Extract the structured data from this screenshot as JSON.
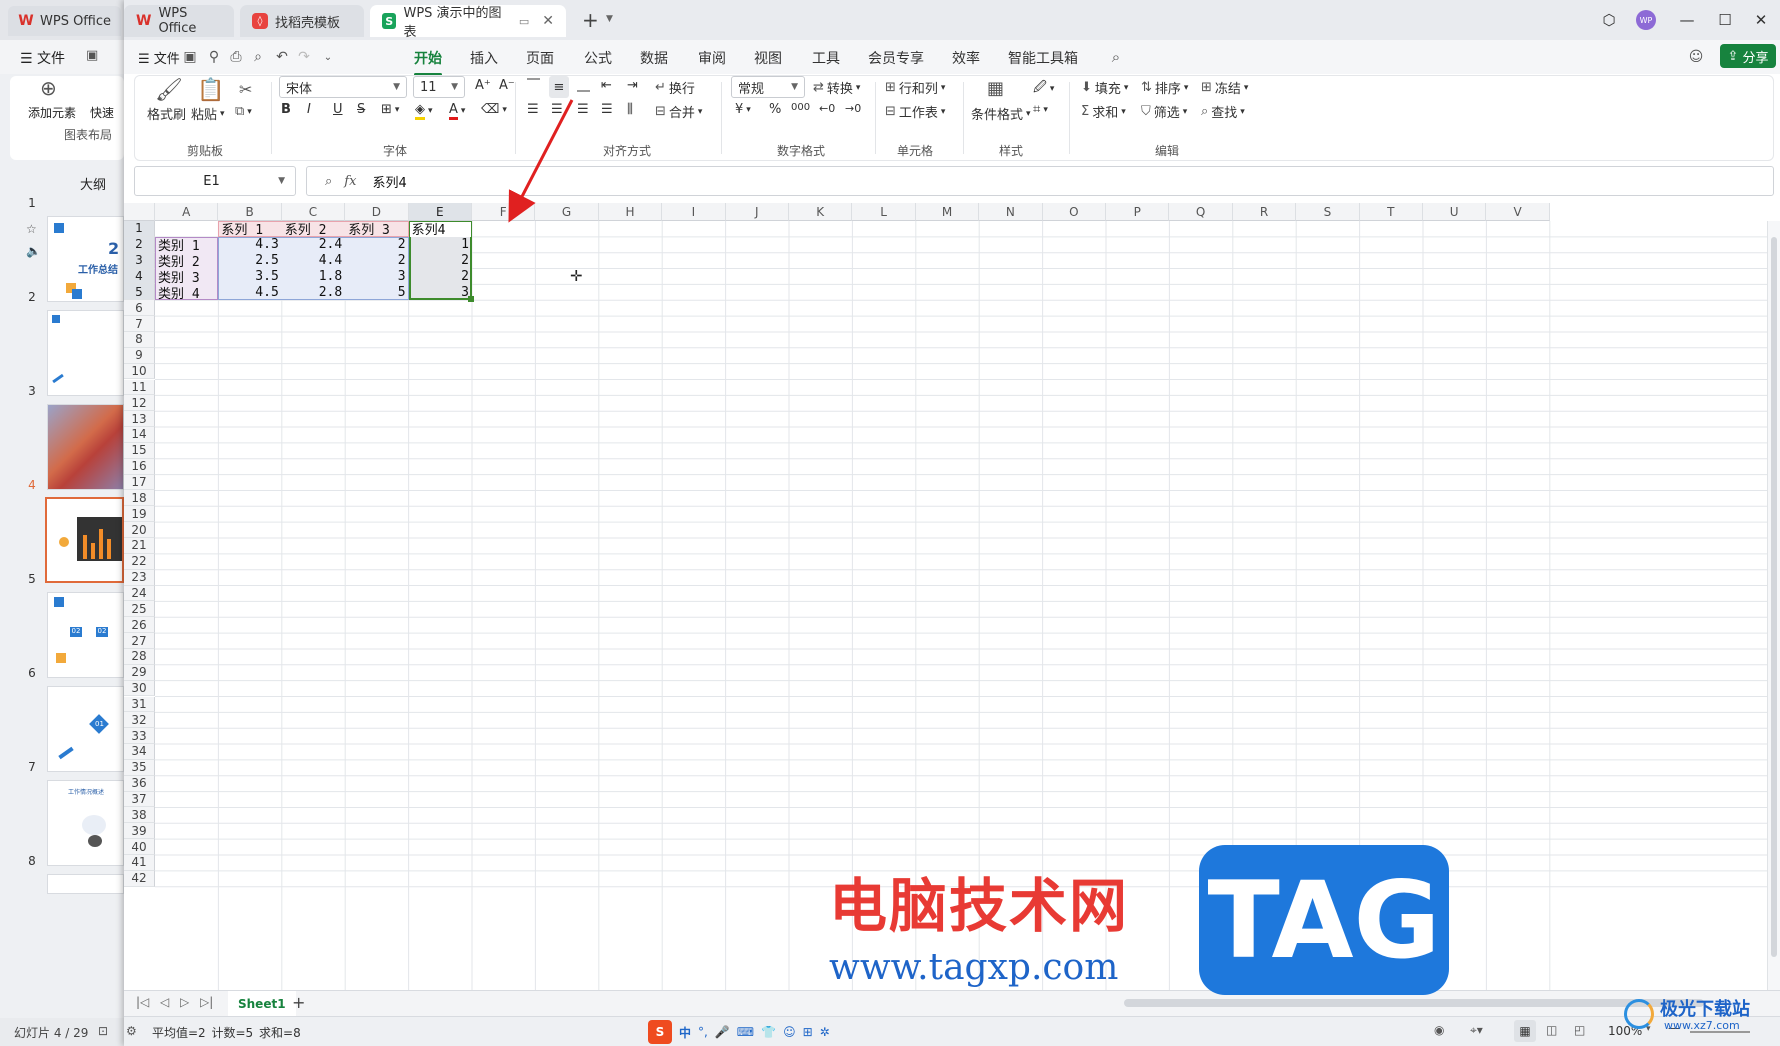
{
  "background_window": {
    "tabs": [
      "WPS Office"
    ],
    "menu_file": "文件",
    "ribbon": {
      "add_element": "添加元素",
      "quick": "快速",
      "group_label": "图表布局"
    },
    "outline_label": "大纲",
    "slide_numbers": [
      "1",
      "2",
      "3",
      "4",
      "5",
      "6",
      "7",
      "8"
    ],
    "slide_texts": {
      "s1_year": "2",
      "s1_title": "工作总结",
      "s5_a": "02",
      "s5_b": "02",
      "s6_a": "01",
      "s7_title": "工作情况概述"
    },
    "status_slide": "幻灯片 4 / 29"
  },
  "titlebar": {
    "tabs": [
      {
        "label": "WPS Office"
      },
      {
        "label": "找稻壳模板"
      },
      {
        "label": "WPS 演示中的图表"
      }
    ],
    "new_tab": "+",
    "avatar": "WP"
  },
  "menubar": {
    "file": "文件",
    "tabs": [
      "开始",
      "插入",
      "页面",
      "公式",
      "数据",
      "审阅",
      "视图",
      "工具",
      "会员专享",
      "效率",
      "智能工具箱"
    ],
    "active_tab": "开始",
    "share": "分享"
  },
  "ribbon": {
    "clipboard": {
      "format_painter": "格式刷",
      "paste": "粘贴",
      "label": "剪贴板"
    },
    "font": {
      "name": "宋体",
      "size": "11",
      "bold": "B",
      "italic": "I",
      "underline": "U",
      "strike": "S",
      "label": "字体"
    },
    "align": {
      "wrap": "换行",
      "merge": "合并",
      "label": "对齐方式"
    },
    "number": {
      "format": "常规",
      "convert": "转换",
      "currency": "¥",
      "percent": "%",
      "thousands": "000",
      "label": "数字格式"
    },
    "cells": {
      "row_col": "行和列",
      "worksheet": "工作表",
      "label": "单元格"
    },
    "styles": {
      "conditional": "条件格式",
      "label": "样式"
    },
    "edit": {
      "fill": "填充",
      "sort": "排序",
      "freeze": "冻结",
      "sum": "求和",
      "filter": "筛选",
      "find": "查找",
      "label": "编辑"
    }
  },
  "formula_bar": {
    "name_box": "E1",
    "fx": "fx",
    "value": "系列4"
  },
  "grid": {
    "columns": [
      "A",
      "B",
      "C",
      "D",
      "E",
      "F",
      "G",
      "H",
      "I",
      "J",
      "K",
      "L",
      "M",
      "N",
      "O",
      "P",
      "Q",
      "R",
      "S",
      "T",
      "U",
      "V"
    ],
    "rows": [
      "1",
      "2",
      "3",
      "4",
      "5",
      "6",
      "7",
      "8",
      "9",
      "10",
      "11",
      "12",
      "13",
      "14",
      "15",
      "16",
      "17",
      "18",
      "19",
      "20",
      "21",
      "22",
      "23",
      "24",
      "25",
      "26",
      "27",
      "28",
      "29",
      "30",
      "31",
      "32",
      "33",
      "34",
      "35",
      "36",
      "37",
      "38",
      "39",
      "40",
      "41",
      "42"
    ],
    "header_row": [
      "",
      "系列 1",
      "系列 2",
      "系列 3",
      "系列4"
    ],
    "data_rows": [
      [
        "类别 1",
        "4.3",
        "2.4",
        "2",
        "1"
      ],
      [
        "类别 2",
        "2.5",
        "4.4",
        "2",
        "2"
      ],
      [
        "类别 3",
        "3.5",
        "1.8",
        "3",
        "2"
      ],
      [
        "类别 4",
        "4.5",
        "2.8",
        "5",
        "3"
      ]
    ],
    "selected_cell": "E1"
  },
  "sheet_tabs": {
    "active": "Sheet1",
    "add": "+"
  },
  "statusbar": {
    "summary": "平均值=2  计数=5  求和=8",
    "ime": "中",
    "zoom": "100%"
  },
  "watermark": {
    "cn": "电脑技术网",
    "tag": "TAG",
    "url": "www.tagxp.com",
    "corner": "极光下载站",
    "corner_url": "www.xz7.com"
  },
  "colors": {
    "accent": "#17833e",
    "selection": "#3d8b2c",
    "arrow": "#e02020",
    "wm_red": "#e83a34",
    "wm_blue": "#1e78dc"
  }
}
